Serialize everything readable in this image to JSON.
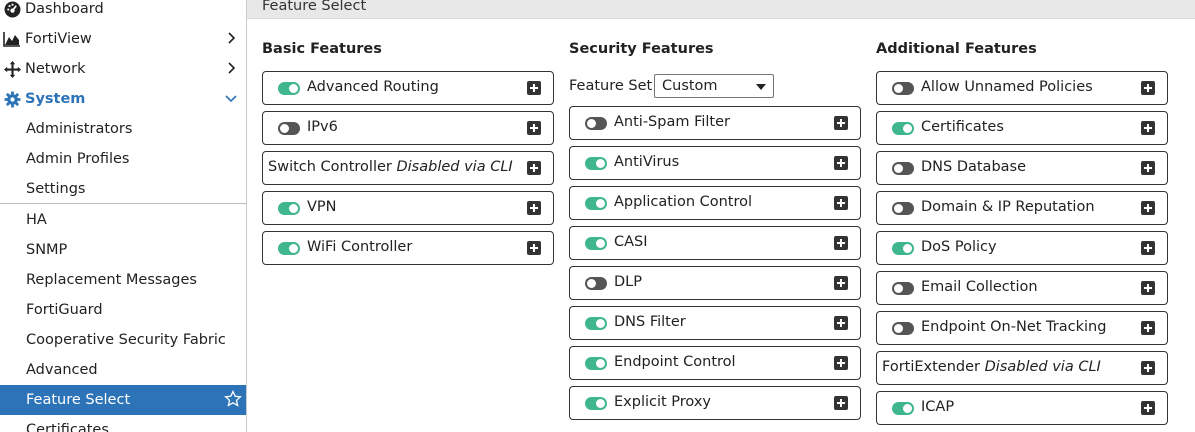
{
  "sidebar": {
    "items": [
      {
        "label": "Dashboard",
        "icon": "dashboard-icon"
      },
      {
        "label": "FortiView",
        "icon": "fortiview-icon",
        "chevron": "right"
      },
      {
        "label": "Network",
        "icon": "network-icon",
        "chevron": "right"
      },
      {
        "label": "System",
        "icon": "gear-icon",
        "chevron": "down",
        "active": true
      }
    ],
    "subitems": [
      "Administrators",
      "Admin Profiles",
      "Settings",
      "HA",
      "SNMP",
      "Replacement Messages",
      "FortiGuard",
      "Cooperative Security Fabric",
      "Advanced",
      "Feature Select",
      "Certificates"
    ],
    "selected": "Feature Select"
  },
  "header": {
    "title": "Feature Select"
  },
  "basic": {
    "title": "Basic Features",
    "features": [
      {
        "label": "Advanced Routing",
        "on": true
      },
      {
        "label": "IPv6",
        "on": false
      },
      {
        "label": "Switch Controller",
        "note": "Disabled via CLI"
      },
      {
        "label": "VPN",
        "on": true
      },
      {
        "label": "WiFi Controller",
        "on": true
      }
    ]
  },
  "security": {
    "title": "Security Features",
    "feature_set_label": "Feature Set:",
    "feature_set_value": "Custom",
    "features": [
      {
        "label": "Anti-Spam Filter",
        "on": false
      },
      {
        "label": "AntiVirus",
        "on": true
      },
      {
        "label": "Application Control",
        "on": true
      },
      {
        "label": "CASI",
        "on": true
      },
      {
        "label": "DLP",
        "on": false
      },
      {
        "label": "DNS Filter",
        "on": true
      },
      {
        "label": "Endpoint Control",
        "on": true
      },
      {
        "label": "Explicit Proxy",
        "on": true
      }
    ]
  },
  "additional": {
    "title": "Additional Features",
    "features": [
      {
        "label": "Allow Unnamed Policies",
        "on": false
      },
      {
        "label": "Certificates",
        "on": true
      },
      {
        "label": "DNS Database",
        "on": false
      },
      {
        "label": "Domain & IP Reputation",
        "on": false
      },
      {
        "label": "DoS Policy",
        "on": true
      },
      {
        "label": "Email Collection",
        "on": false
      },
      {
        "label": "Endpoint On-Net Tracking",
        "on": false
      },
      {
        "label": "FortiExtender",
        "note": "Disabled via CLI"
      },
      {
        "label": "ICAP",
        "on": true
      }
    ]
  },
  "colors": {
    "accent": "#2d73b8",
    "toggle_on": "#3fb68e",
    "toggle_off": "#555555"
  }
}
